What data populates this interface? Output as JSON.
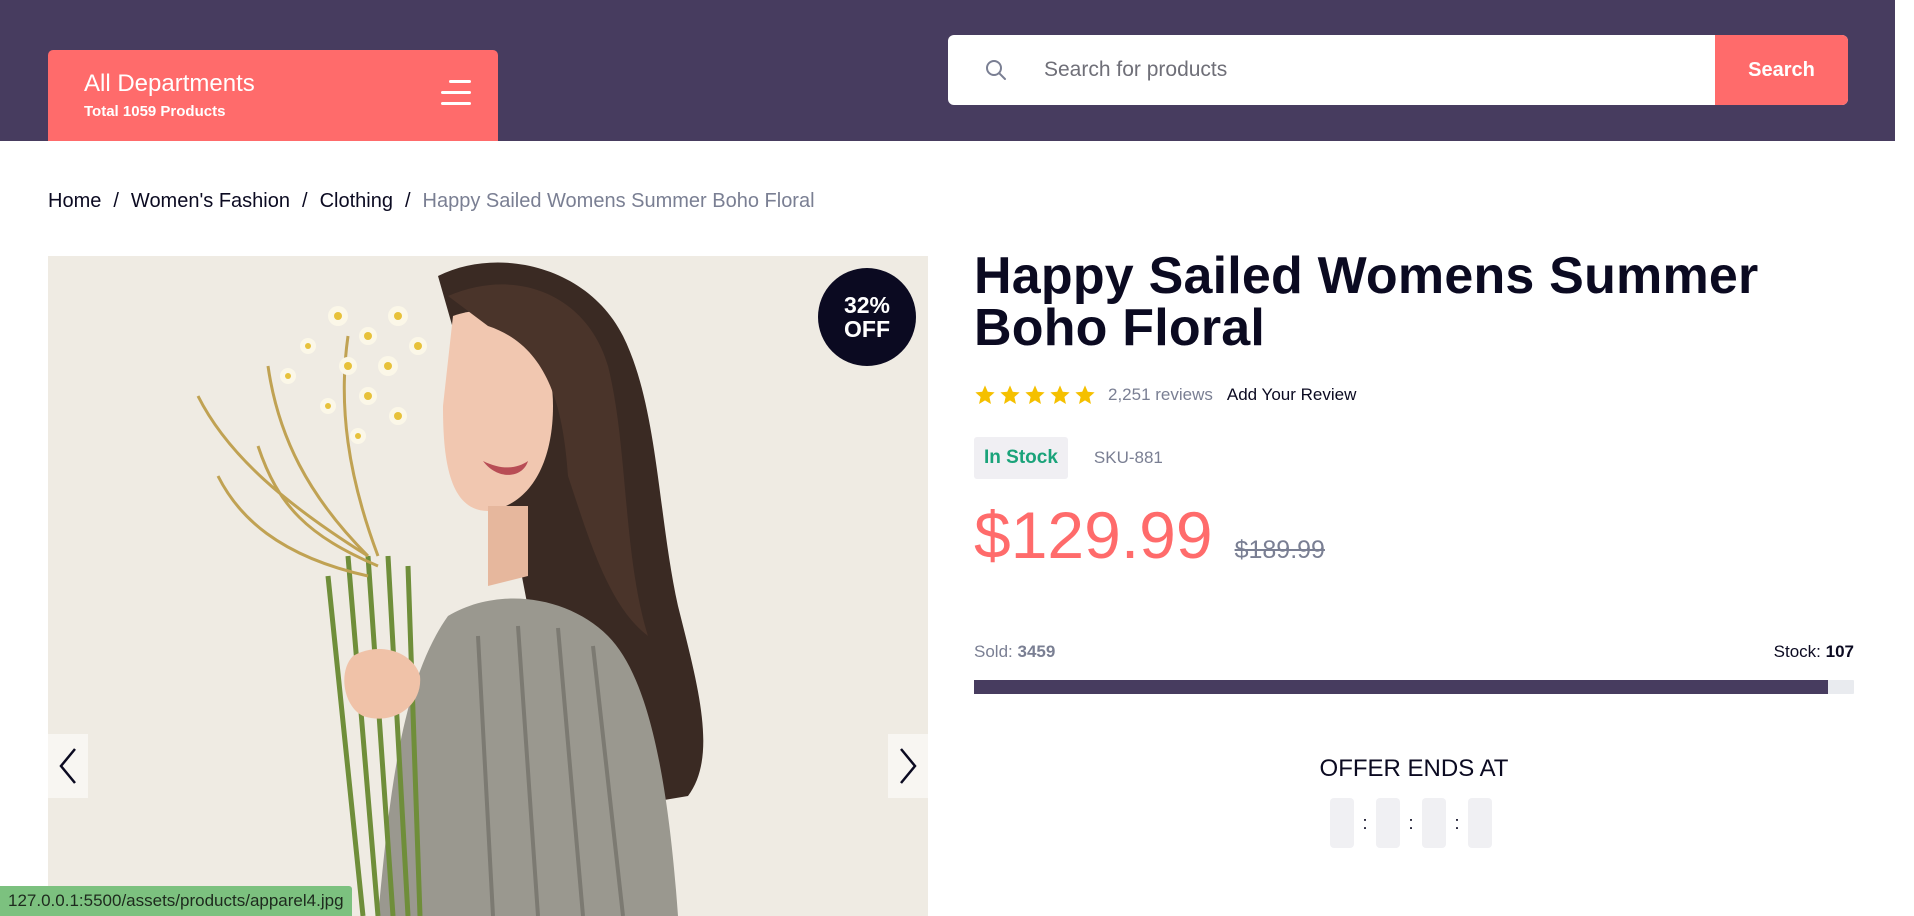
{
  "header": {
    "departments_title": "All Departments",
    "departments_count": "Total 1059 Products",
    "search_placeholder": "Search for products",
    "search_button": "Search"
  },
  "breadcrumb": {
    "items": [
      "Home",
      "Women's Fashion",
      "Clothing"
    ],
    "current": "Happy Sailed Womens Summer Boho Floral"
  },
  "gallery": {
    "discount_line1": "32%",
    "discount_line2": "OFF",
    "prev_icon": "chevron-left-icon",
    "next_icon": "chevron-right-icon"
  },
  "product": {
    "title": "Happy Sailed Womens Summer Boho Floral",
    "rating_stars": 5,
    "review_count": "2,251 reviews",
    "add_review": "Add Your Review",
    "stock_status": "In Stock",
    "sku": "SKU-881",
    "price": "$129.99",
    "old_price": "$189.99",
    "sold_label": "Sold:",
    "sold_value": "3459",
    "stock_label": "Stock:",
    "stock_value": "107",
    "offer_title": "OFFER ENDS AT"
  },
  "status_bar": {
    "url": "127.0.0.1:5500/assets/products/apparel4.jpg"
  },
  "colors": {
    "header_bg": "#473c5f",
    "accent": "#ff6b6b",
    "dark": "#0b0a21",
    "in_stock": "#1aa37a",
    "star": "#f5c000"
  }
}
